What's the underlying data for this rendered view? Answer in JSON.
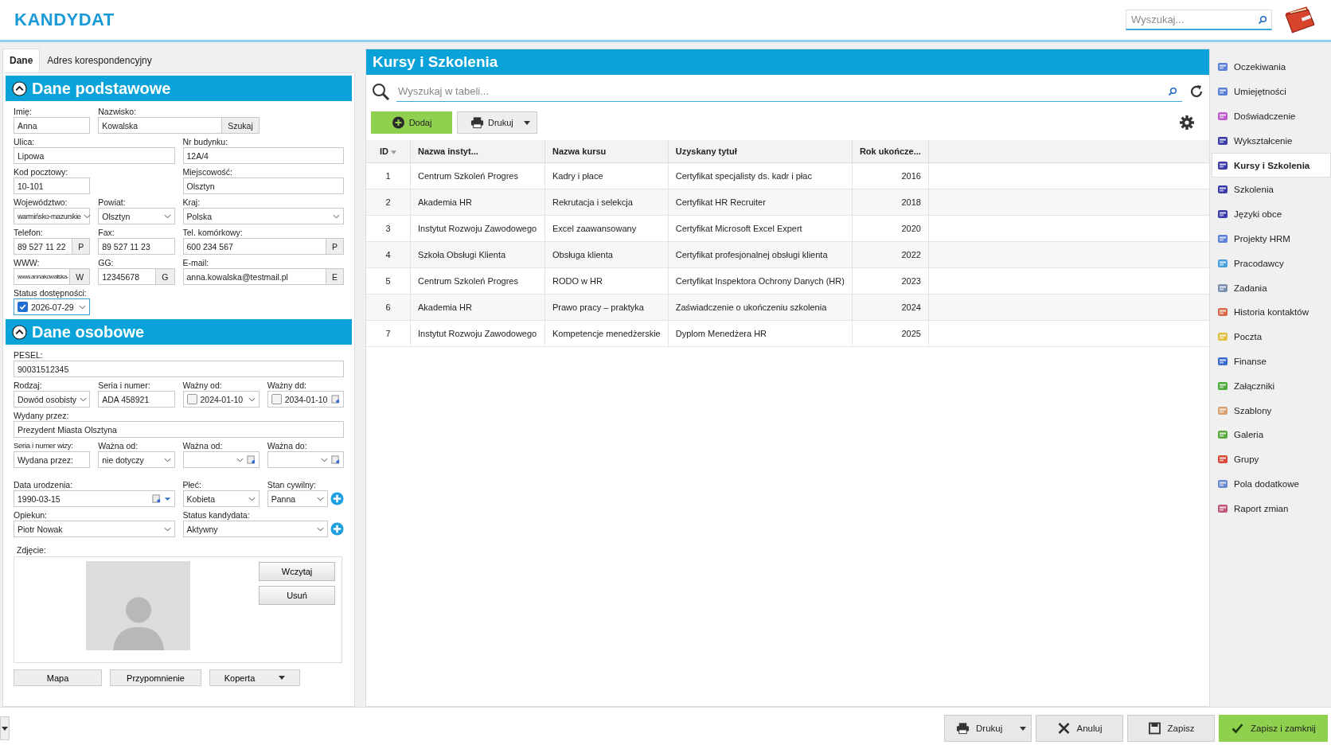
{
  "app_title": "KANDYDAT",
  "header_search": {
    "placeholder": "Wyszukaj..."
  },
  "left_tabs": [
    {
      "label": "Dane",
      "selected": true
    },
    {
      "label": "Adres korespondencyjny",
      "selected": false
    }
  ],
  "sections": [
    {
      "title": "Dane podstawowe",
      "expanded": true,
      "rows": [
        [
          {
            "label": "Imię:",
            "value": "Anna",
            "kind": "text"
          },
          {
            "label": "Nazwisko:",
            "value": "Kowalska",
            "kind": "text",
            "button": "Szukaj"
          }
        ],
        [
          {
            "label": "Ulica:",
            "value": "Lipowa",
            "kind": "text"
          },
          {
            "label": "Nr budynku:",
            "value": "12A/4",
            "kind": "text"
          }
        ],
        [
          {
            "label": "Kod pocztowy:",
            "value": "10-101",
            "kind": "text"
          },
          {
            "label": "Miejscowość:",
            "value": "Olsztyn",
            "kind": "text"
          }
        ],
        [
          {
            "label": "Województwo:",
            "value": "warmińsko-mazurskie",
            "kind": "select"
          },
          {
            "label": "Powiat:",
            "value": "Olsztyn",
            "kind": "select"
          },
          {
            "label": "Kraj:",
            "value": "Polska",
            "kind": "select"
          }
        ],
        [
          {
            "label": "Telefon:",
            "value": "89 527 11 22",
            "kind": "text",
            "button": "P"
          },
          {
            "label": "Fax:",
            "value": "89 527 11 23",
            "kind": "text"
          },
          {
            "label": "Tel. komórkowy:",
            "value": "600 234 567",
            "kind": "text",
            "button": "P"
          }
        ],
        [
          {
            "label": "WWW:",
            "value": "www.annakowalska-",
            "kind": "text",
            "button": "W"
          },
          {
            "label": "GG:",
            "value": "12345678",
            "kind": "text",
            "button": "G"
          },
          {
            "label": "E-mail:",
            "value": "anna.kowalska@testmail.pl",
            "kind": "text",
            "button": "E"
          }
        ],
        [
          {
            "label": "Status dostępności:",
            "value": "2026-07-29",
            "kind": "check-date",
            "checked": true
          }
        ]
      ]
    },
    {
      "title": "Dane osobowe",
      "expanded": true,
      "rows": [
        [
          {
            "label": "PESEL:",
            "value": "90031512345",
            "kind": "text"
          }
        ],
        [
          {
            "label": "Rodzaj:",
            "value": "Dowód osobisty",
            "kind": "select"
          },
          {
            "label": "Seria i numer:",
            "value": "ADA 458921",
            "kind": "text"
          },
          {
            "label": "Ważny od:",
            "value": "2024-01-10",
            "kind": "check-date",
            "checked": false
          },
          {
            "label": "Ważny dd:",
            "value": "2034-01-10",
            "kind": "check-date-cal",
            "checked": false
          }
        ],
        [
          {
            "label": "Wydany przez:",
            "value": "Prezydent Miasta Olsztyna",
            "kind": "text"
          }
        ],
        [
          {
            "label": "Seria i numer wizy:",
            "value": "Wydana przez:",
            "kind": "text"
          },
          {
            "label": "Ważna od:",
            "value": "nie dotyczy",
            "kind": "select"
          },
          {
            "label": "Ważna od:",
            "kind": "empty-date"
          },
          {
            "label": "Ważna do:",
            "kind": "empty-date"
          }
        ]
      ],
      "rows_lower": [
        [
          {
            "label": "Data urodzenia:",
            "value": "1990-03-15",
            "kind": "date-cal"
          },
          {
            "label": "Płeć:",
            "value": "Kobieta",
            "kind": "select"
          },
          {
            "label": "Stan cywilny:",
            "value": "Panna",
            "kind": "select",
            "add": true
          }
        ],
        [
          {
            "label": "Opiekun:",
            "value": "Piotr Nowak",
            "kind": "select"
          },
          {
            "label": "Status kandydata:",
            "value": "Aktywny",
            "kind": "select",
            "add": true
          }
        ]
      ]
    }
  ],
  "photo": {
    "label": "Zdjęcie:",
    "buttons": [
      "Wczytaj",
      "Usuń"
    ]
  },
  "bottom_buttons": [
    {
      "label": "Mapa",
      "dropdown": false
    },
    {
      "label": "Przypomnienie",
      "dropdown": false
    },
    {
      "label": "Koperta",
      "dropdown": true
    }
  ],
  "panel": {
    "title": "Kursy i Szkolenia",
    "search_placeholder": "Wyszukaj w tabeli...",
    "toolbar": [
      {
        "label": "Dodaj",
        "kind": "add"
      },
      {
        "label": "Drukuj",
        "kind": "print"
      }
    ],
    "table": {
      "columns": [
        {
          "label": "ID",
          "sorted": true
        },
        {
          "label": "Nazwa instyt...",
          "sorted": false
        },
        {
          "label": "Nazwa kursu",
          "sorted": false
        },
        {
          "label": "Uzyskany tytuł",
          "sorted": false
        },
        {
          "label": "Rok ukończe...",
          "sorted": false
        }
      ],
      "rows": [
        [
          "1",
          "Centrum Szkoleń Progres",
          "Kadry i płace",
          "Certyfikat specjalisty ds. kadr i płac",
          "2016"
        ],
        [
          "2",
          "Akademia HR",
          "Rekrutacja i selekcja",
          "Certyfikat HR Recruiter",
          "2018"
        ],
        [
          "3",
          "Instytut Rozwoju Zawodowego",
          "Excel zaawansowany",
          "Certyfikat Microsoft Excel Expert",
          "2020"
        ],
        [
          "4",
          "Szkoła Obsługi Klienta",
          "Obsługa klienta",
          "Certyfikat profesjonalnej obsługi klienta",
          "2022"
        ],
        [
          "5",
          "Centrum Szkoleń Progres",
          "RODO w HR",
          "Certyfikat Inspektora Ochrony Danych (HR)",
          "2023"
        ],
        [
          "6",
          "Akademia HR",
          "Prawo pracy – praktyka",
          "Zaświadczenie o ukończeniu szkolenia",
          "2024"
        ],
        [
          "7",
          "Instytut Rozwoju Zawodowego",
          "Kompetencje menedżerskie",
          "Dyplom Menedżera HR",
          "2025"
        ]
      ]
    }
  },
  "sidebar": {
    "items": [
      {
        "label": "Oczekiwania",
        "selected": false
      },
      {
        "label": "Umiejętności",
        "selected": false
      },
      {
        "label": "Doświadczenie",
        "selected": false
      },
      {
        "label": "Wykształcenie",
        "selected": false
      },
      {
        "label": "Kursy i Szkolenia",
        "selected": true
      },
      {
        "label": "Szkolenia",
        "selected": false
      },
      {
        "label": "Języki obce",
        "selected": false
      },
      {
        "label": "Projekty HRM",
        "selected": false
      },
      {
        "label": "Pracodawcy",
        "selected": false
      },
      {
        "label": "Zadania",
        "selected": false
      },
      {
        "label": "Historia kontaktów",
        "selected": false
      },
      {
        "label": "Poczta",
        "selected": false
      },
      {
        "label": "Finanse",
        "selected": false
      },
      {
        "label": "Załączniki",
        "selected": false
      },
      {
        "label": "Szablony",
        "selected": false
      },
      {
        "label": "Galeria",
        "selected": false
      },
      {
        "label": "Grupy",
        "selected": false
      },
      {
        "label": "Pola dodatkowe",
        "selected": false
      },
      {
        "label": "Raport zmian",
        "selected": false
      }
    ]
  },
  "footer": {
    "buttons": [
      {
        "label": "Drukuj",
        "kind": "print"
      },
      {
        "label": "Anuluj",
        "kind": "cancel"
      },
      {
        "label": "Zapisz",
        "kind": "save"
      },
      {
        "label": "Zapisz i zamknij",
        "kind": "save-close"
      }
    ]
  }
}
